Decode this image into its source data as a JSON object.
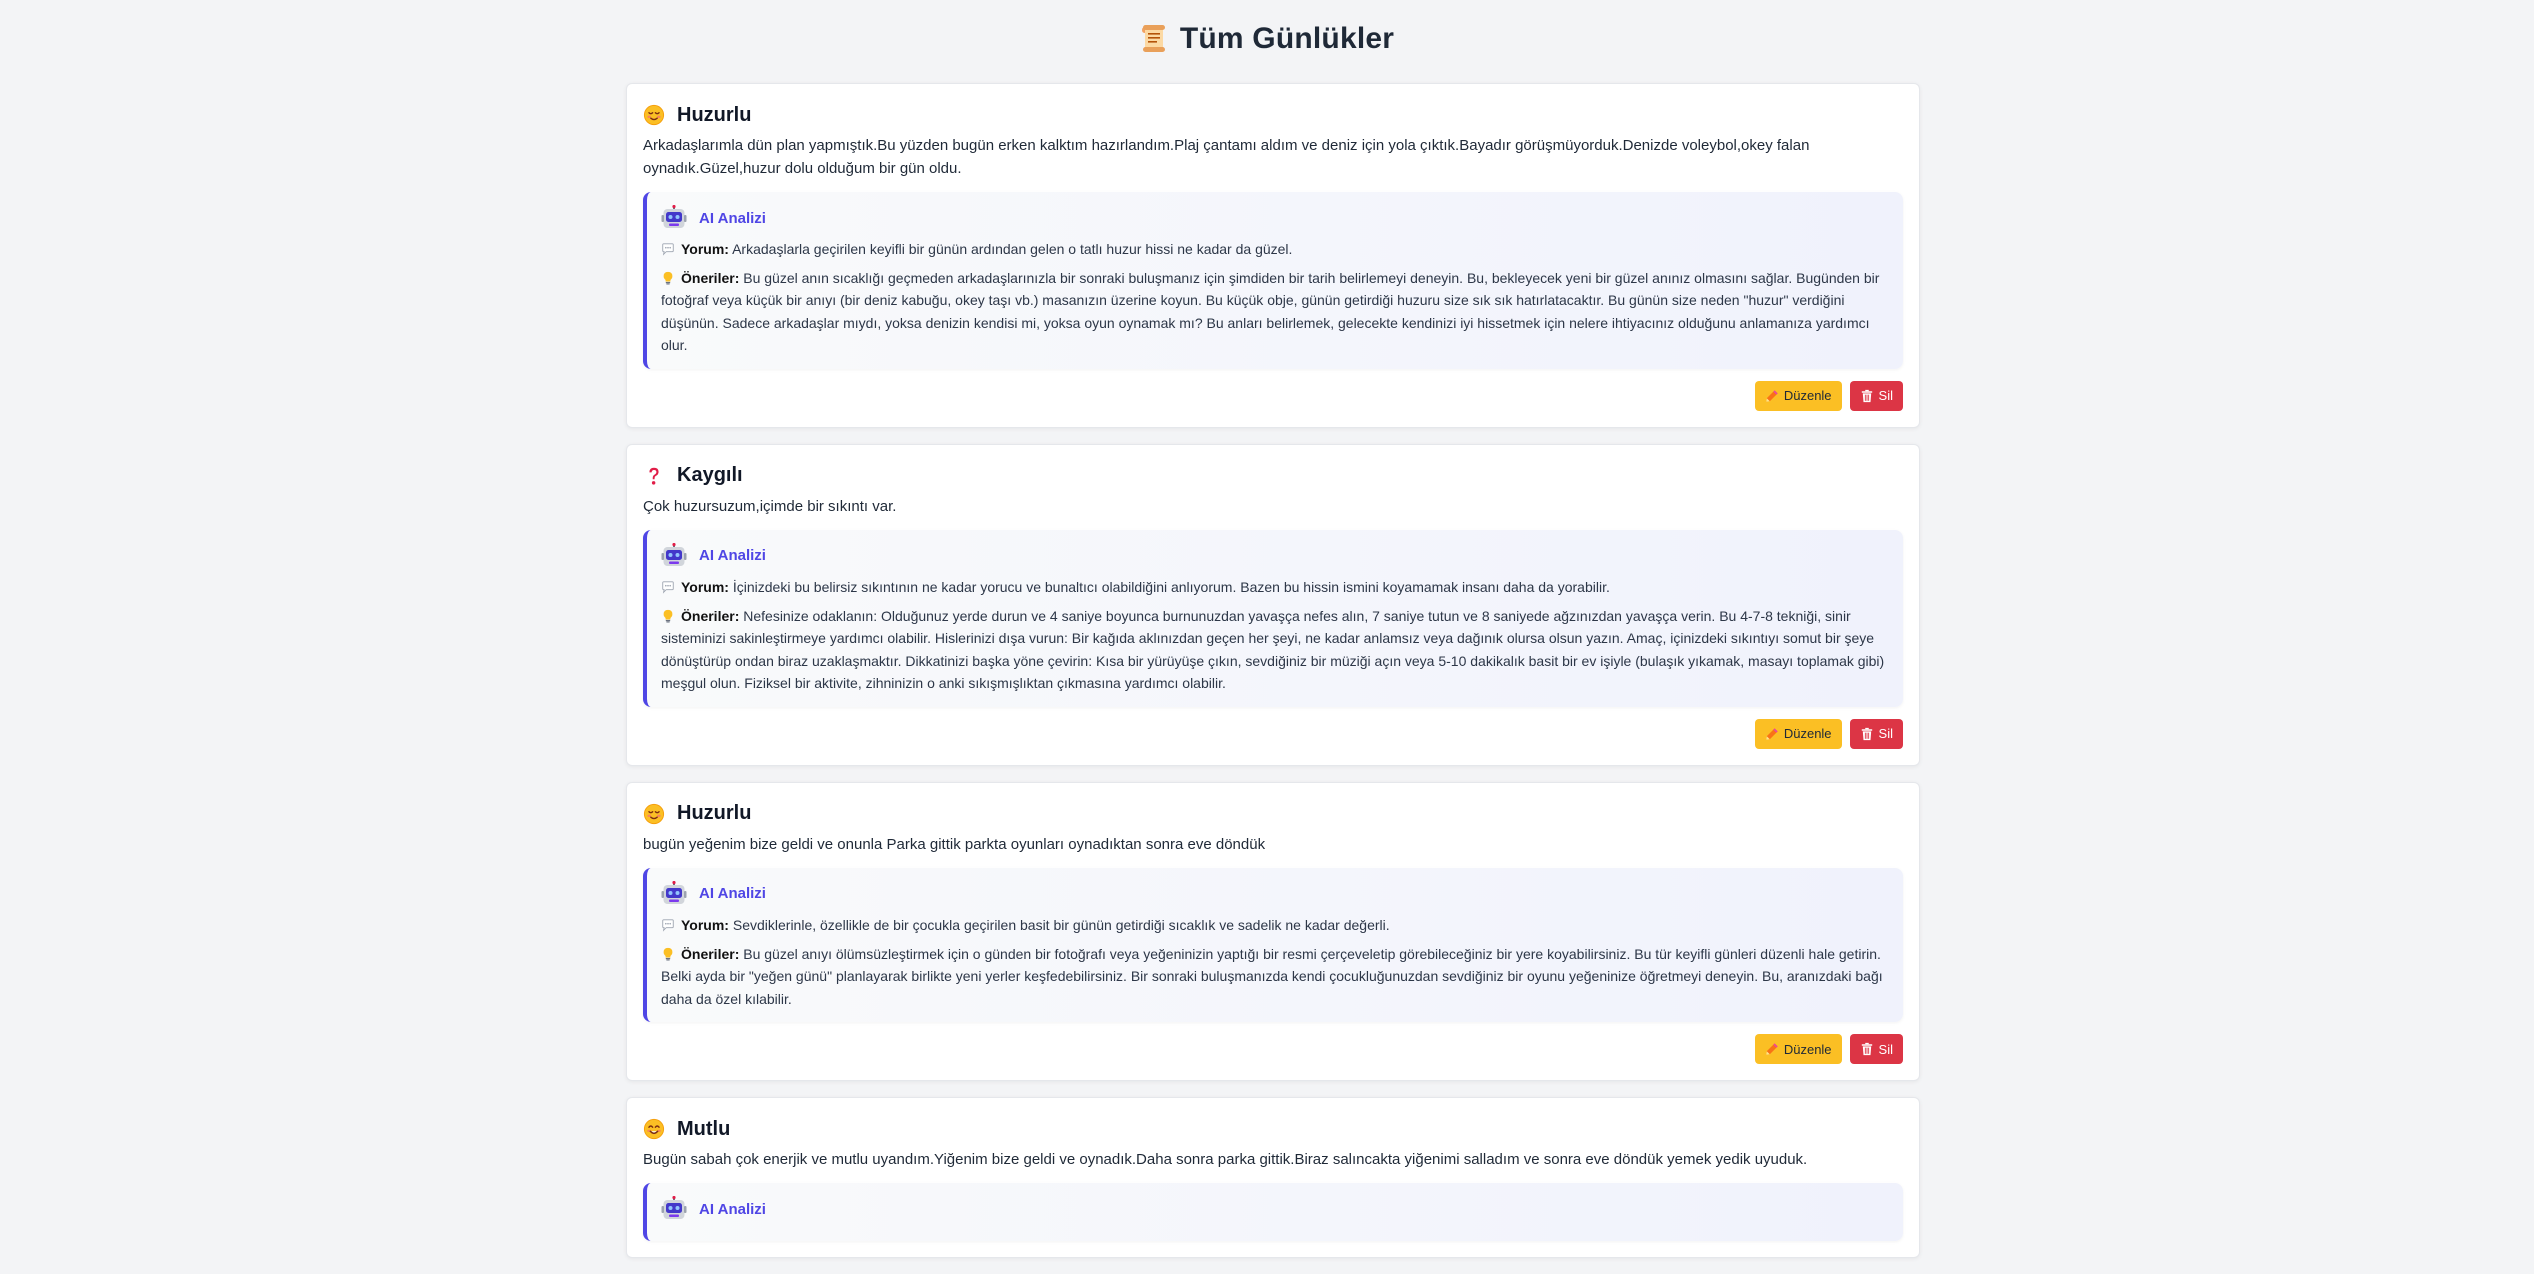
{
  "page": {
    "title": "Tüm Günlükler",
    "title_icon": "scroll-icon"
  },
  "labels": {
    "ai_title": "AI Analizi",
    "comment_label": "Yorum:",
    "suggestions_label": "Öneriler:",
    "edit_button": "Düzenle",
    "delete_button": "Sil"
  },
  "colors": {
    "accent": "#4f46e5",
    "edit": "#fbbf24",
    "delete": "#dc3545"
  },
  "entries": [
    {
      "mood": "Huzurlu",
      "mood_icon": "relieved-face-icon",
      "text": "Arkadaşlarımla dün plan yapmıştık.Bu yüzden bugün erken kalktım hazırlandım.Plaj çantamı aldım ve deniz için yola çıktık.Bayadır görüşmüyorduk.Denizde voleybol,okey falan oynadık.Güzel,huzur dolu olduğum bir gün oldu.",
      "comment": "Arkadaşlarla geçirilen keyifli bir günün ardından gelen o tatlı huzur hissi ne kadar da güzel.",
      "suggestions": "Bu güzel anın sıcaklığı geçmeden arkadaşlarınızla bir sonraki buluşmanız için şimdiden bir tarih belirlemeyi deneyin. Bu, bekleyecek yeni bir güzel anınız olmasını sağlar. Bugünden bir fotoğraf veya küçük bir anıyı (bir deniz kabuğu, okey taşı vb.) masanızın üzerine koyun. Bu küçük obje, günün getirdiği huzuru size sık sık hatırlatacaktır. Bu günün size neden \"huzur\" verdiğini düşünün. Sadece arkadaşlar mıydı, yoksa denizin kendisi mi, yoksa oyun oynamak mı? Bu anları belirlemek, gelecekte kendinizi iyi hissetmek için nelere ihtiyacınız olduğunu anlamanıza yardımcı olur."
    },
    {
      "mood": "Kaygılı",
      "mood_icon": "question-mark-icon",
      "text": "Çok huzursuzum,içimde bir sıkıntı var.",
      "comment": "İçinizdeki bu belirsiz sıkıntının ne kadar yorucu ve bunaltıcı olabildiğini anlıyorum. Bazen bu hissin ismini koyamamak insanı daha da yorabilir.",
      "suggestions": "Nefesinize odaklanın: Olduğunuz yerde durun ve 4 saniye boyunca burnunuzdan yavaşça nefes alın, 7 saniye tutun ve 8 saniyede ağzınızdan yavaşça verin. Bu 4-7-8 tekniği, sinir sisteminizi sakinleştirmeye yardımcı olabilir. Hislerinizi dışa vurun: Bir kağıda aklınızdan geçen her şeyi, ne kadar anlamsız veya dağınık olursa olsun yazın. Amaç, içinizdeki sıkıntıyı somut bir şeye dönüştürüp ondan biraz uzaklaşmaktır. Dikkatinizi başka yöne çevirin: Kısa bir yürüyüşe çıkın, sevdiğiniz bir müziği açın veya 5-10 dakikalık basit bir ev işiyle (bulaşık yıkamak, masayı toplamak gibi) meşgul olun. Fiziksel bir aktivite, zihninizin o anki sıkışmışlıktan çıkmasına yardımcı olabilir."
    },
    {
      "mood": "Huzurlu",
      "mood_icon": "relieved-face-icon",
      "text": "bugün yeğenim bize geldi ve onunla Parka gittik parkta oyunları oynadıktan sonra eve döndük",
      "comment": "Sevdiklerinle, özellikle de bir çocukla geçirilen basit bir günün getirdiği sıcaklık ve sadelik ne kadar değerli.",
      "suggestions": "Bu güzel anıyı ölümsüzleştirmek için o günden bir fotoğrafı veya yeğeninizin yaptığı bir resmi çerçeveletip görebileceğiniz bir yere koyabilirsiniz. Bu tür keyifli günleri düzenli hale getirin. Belki ayda bir \"yeğen günü\" planlayarak birlikte yeni yerler keşfedebilirsiniz. Bir sonraki buluşmanızda kendi çocukluğunuzdan sevdiğiniz bir oyunu yeğeninize öğretmeyi deneyin. Bu, aranızdaki bağı daha da özel kılabilir."
    },
    {
      "mood": "Mutlu",
      "mood_icon": "smiling-face-icon",
      "text": "Bugün sabah çok enerjik ve mutlu uyandım.Yiğenim bize geldi ve oynadık.Daha sonra parka gittik.Biraz salıncakta yiğenimi salladım ve sonra eve döndük yemek yedik uyuduk."
    }
  ]
}
